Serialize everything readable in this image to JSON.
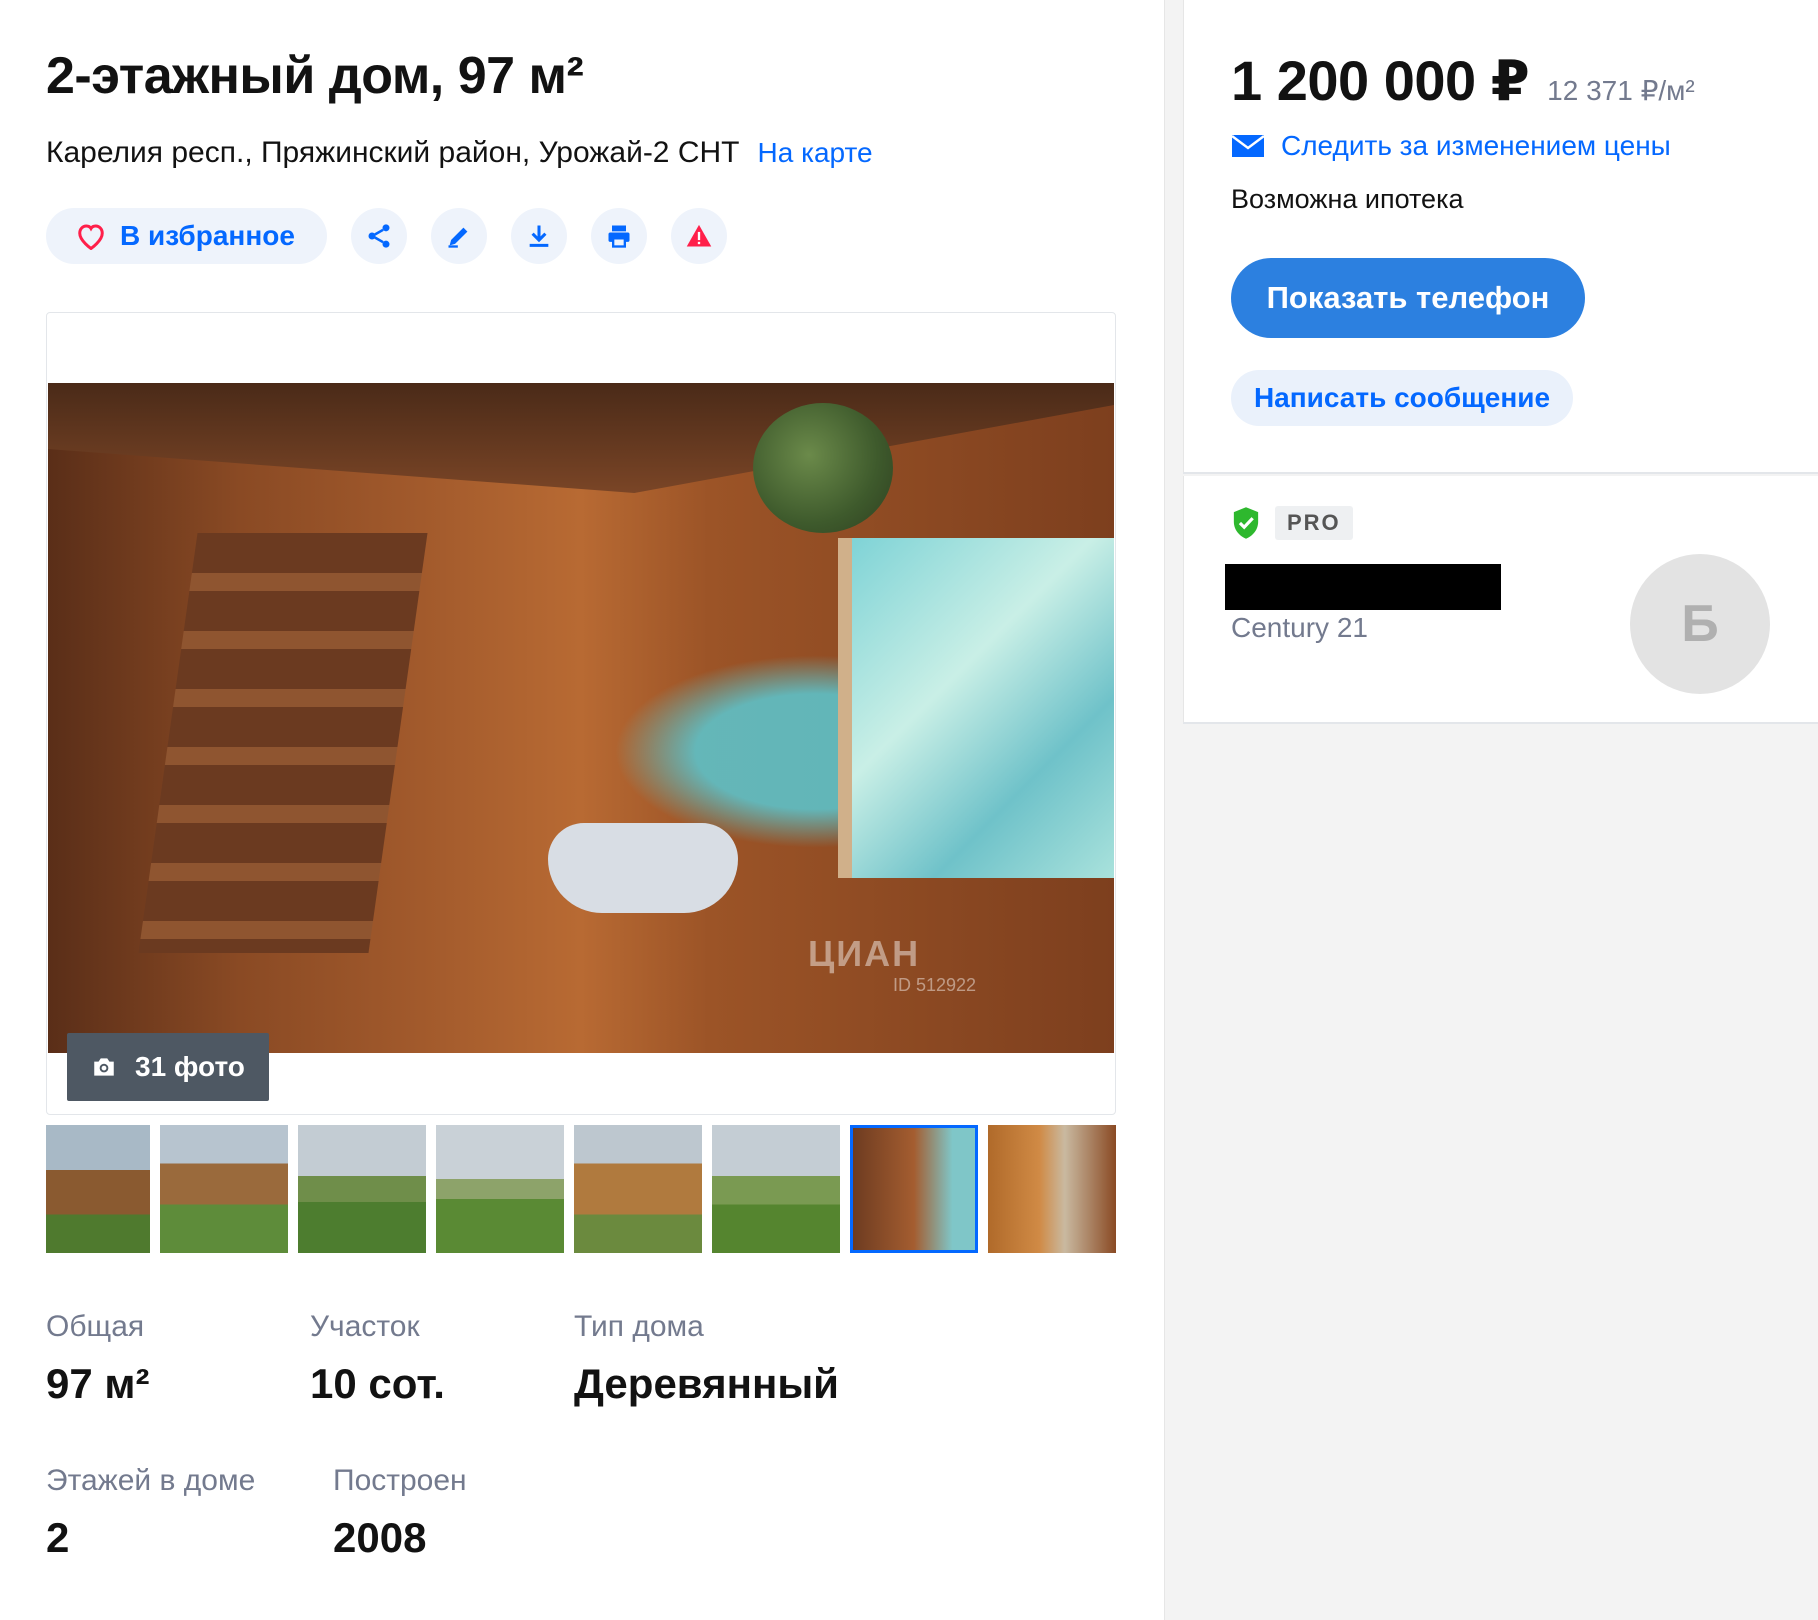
{
  "listing": {
    "title": "2-этажный дом, 97 м²",
    "address": "Карелия респ., Пряжинский район, Урожай-2 СНТ",
    "map_link": "На карте"
  },
  "actions": {
    "favorite_label": "В избранное",
    "buttons": [
      "share-icon",
      "edit-icon",
      "download-icon",
      "print-icon",
      "warning-icon"
    ]
  },
  "gallery": {
    "photo_count": "31 фото",
    "watermark": "ЦИАН",
    "watermark_id": "ID 512922",
    "thumbnails_count": 8,
    "active_thumbnail": 7
  },
  "specs": [
    {
      "label": "Общая",
      "value": "97 м²"
    },
    {
      "label": "Участок",
      "value": "10 сот."
    },
    {
      "label": "Тип дома",
      "value": "Деревянный"
    },
    {
      "label": "Этажей в доме",
      "value": "2"
    },
    {
      "label": "Построен",
      "value": "2008"
    }
  ],
  "sidebar": {
    "price": "1 200 000 ₽",
    "price_per_m2": "12 371 ₽/м²",
    "track_price": "Следить за изменением цены",
    "mortgage": "Возможна ипотека",
    "show_phone": "Показать телефон",
    "write_message": "Написать сообщение",
    "agent": {
      "badge": "PRO",
      "agency": "Century 21",
      "avatar_letter": "Б"
    }
  },
  "colors": {
    "accent": "#0468ff",
    "button_primary": "#2c80e0",
    "heart": "#ff1f4a",
    "warning": "#ff1f4a",
    "verified": "#2eb82e"
  }
}
